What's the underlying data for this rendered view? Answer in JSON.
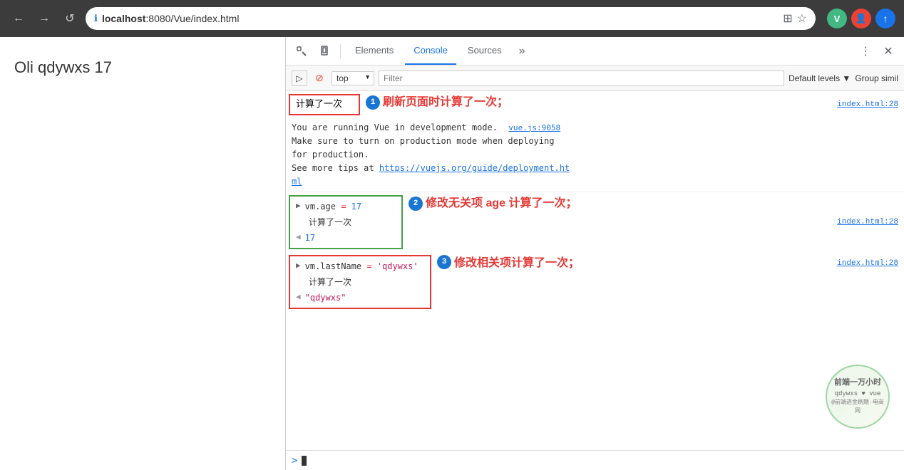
{
  "browser": {
    "url": "localhost:8080/Vue/index.html",
    "url_protocol": "http://",
    "back_label": "←",
    "forward_label": "→",
    "refresh_label": "↺"
  },
  "page": {
    "title": "Oli qdywxs 17"
  },
  "devtools": {
    "tabs": [
      {
        "label": "Elements",
        "active": false
      },
      {
        "label": "Console",
        "active": true
      },
      {
        "label": "Sources",
        "active": false
      }
    ],
    "more_label": "»",
    "context": "top",
    "filter_placeholder": "Filter",
    "levels_label": "Default levels ▼",
    "group_label": "Group simil"
  },
  "console": {
    "entries": [
      {
        "type": "log",
        "text": "计算了一次",
        "link": "index.html:28",
        "highlighted": "red",
        "annotation_num": "1",
        "annotation_text": "刷新页面时计算了一次；"
      },
      {
        "type": "info",
        "lines": [
          "You are running Vue in development mode.  ",
          "Make sure to turn on production mode when deploying",
          "for production.",
          "See more tips at https://vuejs.org/guide/deployment.html"
        ],
        "link": "vue.js:9058",
        "link_url": "https://vuejs.org/guide/deployment.html"
      },
      {
        "type": "group",
        "command": "vm.age = 17",
        "sub_text": "计算了一次",
        "result": "17",
        "link": "index.html:28",
        "highlighted": "green",
        "annotation_num": "2",
        "annotation_text": "修改无关项 age 计算了一次；"
      },
      {
        "type": "group",
        "command": "vm.lastName = 'qdywxs'",
        "sub_text": "计算了一次",
        "result": "\"qdywxs\"",
        "link": "index.html:28",
        "highlighted": "red",
        "annotation_num": "3",
        "annotation_text": "修改相关项计算了一次；"
      }
    ],
    "input_prompt": ">"
  },
  "watermark": {
    "line1": "前端一万小时",
    "line2": "qdywxs ♥ vue",
    "line3": "@前端进金刷题·电商网"
  }
}
